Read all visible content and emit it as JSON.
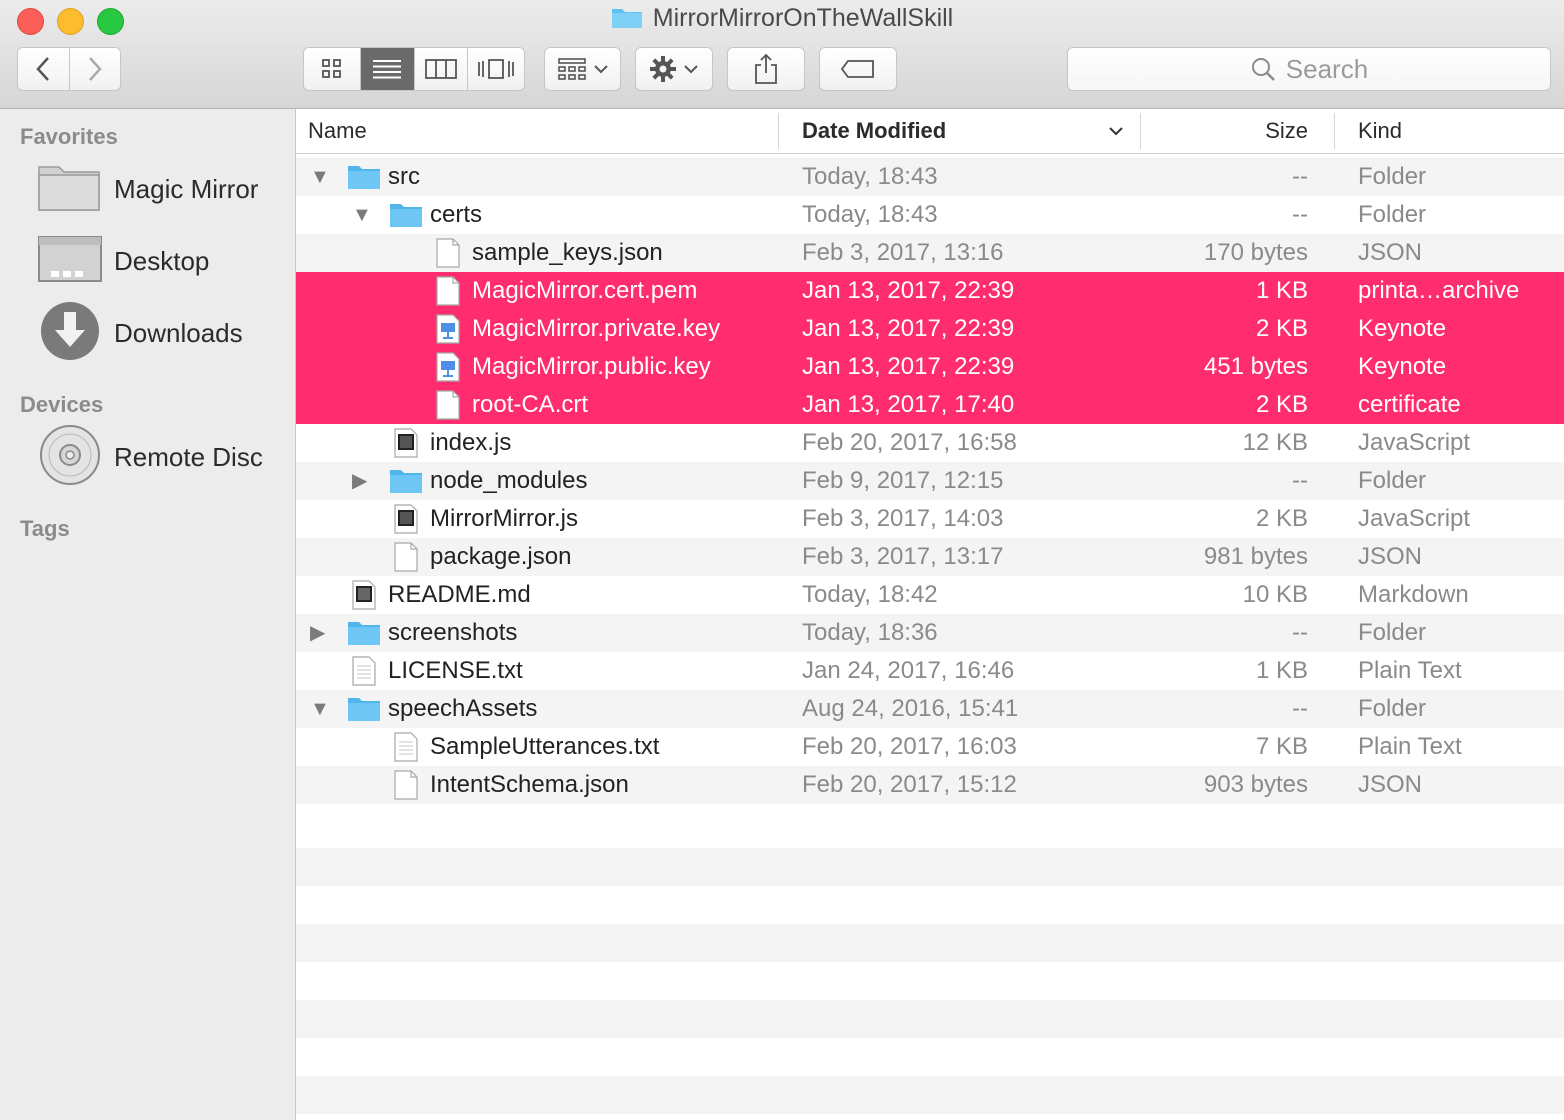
{
  "window": {
    "title": "MirrorMirrorOnTheWallSkill"
  },
  "toolbar": {
    "search_placeholder": "Search",
    "view_modes": [
      "icon-view",
      "list-view",
      "column-view",
      "cover-flow-view"
    ],
    "active_view": "list-view"
  },
  "sidebar": {
    "favorites_header": "Favorites",
    "favorites": [
      {
        "label": "Magic Mirror",
        "icon": "folder-icon"
      },
      {
        "label": "Desktop",
        "icon": "desktop-icon"
      },
      {
        "label": "Downloads",
        "icon": "downloads-icon"
      }
    ],
    "devices_header": "Devices",
    "devices": [
      {
        "label": "Remote Disc",
        "icon": "disc-icon"
      }
    ],
    "tags_header": "Tags"
  },
  "columns": {
    "name": "Name",
    "date": "Date Modified",
    "size": "Size",
    "kind": "Kind"
  },
  "rows": [
    {
      "name": "src",
      "date": "Today, 18:43",
      "size": "--",
      "kind": "Folder",
      "level": 0,
      "type": "folder",
      "expanded": true,
      "selected": false
    },
    {
      "name": "certs",
      "date": "Today, 18:43",
      "size": "--",
      "kind": "Folder",
      "level": 1,
      "type": "folder",
      "expanded": true,
      "selected": false
    },
    {
      "name": "sample_keys.json",
      "date": "Feb 3, 2017, 13:16",
      "size": "170 bytes",
      "kind": "JSON",
      "level": 2,
      "type": "file",
      "selected": false
    },
    {
      "name": "MagicMirror.cert.pem",
      "date": "Jan 13, 2017, 22:39",
      "size": "1 KB",
      "kind": "printa…archive",
      "level": 2,
      "type": "file",
      "selected": true
    },
    {
      "name": "MagicMirror.private.key",
      "date": "Jan 13, 2017, 22:39",
      "size": "2 KB",
      "kind": "Keynote",
      "level": 2,
      "type": "keynote",
      "selected": true
    },
    {
      "name": "MagicMirror.public.key",
      "date": "Jan 13, 2017, 22:39",
      "size": "451 bytes",
      "kind": "Keynote",
      "level": 2,
      "type": "keynote",
      "selected": true
    },
    {
      "name": "root-CA.crt",
      "date": "Jan 13, 2017, 17:40",
      "size": "2 KB",
      "kind": "certificate",
      "level": 2,
      "type": "file",
      "selected": true
    },
    {
      "name": "index.js",
      "date": "Feb 20, 2017, 16:58",
      "size": "12 KB",
      "kind": "JavaScript",
      "level": 1,
      "type": "js",
      "selected": false
    },
    {
      "name": "node_modules",
      "date": "Feb 9, 2017, 12:15",
      "size": "--",
      "kind": "Folder",
      "level": 1,
      "type": "folder",
      "expanded": false,
      "selected": false
    },
    {
      "name": "MirrorMirror.js",
      "date": "Feb 3, 2017, 14:03",
      "size": "2 KB",
      "kind": "JavaScript",
      "level": 1,
      "type": "js",
      "selected": false
    },
    {
      "name": "package.json",
      "date": "Feb 3, 2017, 13:17",
      "size": "981 bytes",
      "kind": "JSON",
      "level": 1,
      "type": "file",
      "selected": false
    },
    {
      "name": "README.md",
      "date": "Today, 18:42",
      "size": "10 KB",
      "kind": "Markdown",
      "level": 0,
      "type": "md",
      "selected": false
    },
    {
      "name": "screenshots",
      "date": "Today, 18:36",
      "size": "--",
      "kind": "Folder",
      "level": 0,
      "type": "folder",
      "expanded": false,
      "selected": false
    },
    {
      "name": "LICENSE.txt",
      "date": "Jan 24, 2017, 16:46",
      "size": "1 KB",
      "kind": "Plain Text",
      "level": 0,
      "type": "txt",
      "selected": false
    },
    {
      "name": "speechAssets",
      "date": "Aug 24, 2016, 15:41",
      "size": "--",
      "kind": "Folder",
      "level": 0,
      "type": "folder",
      "expanded": true,
      "selected": false
    },
    {
      "name": "SampleUtterances.txt",
      "date": "Feb 20, 2017, 16:03",
      "size": "7 KB",
      "kind": "Plain Text",
      "level": 1,
      "type": "txt",
      "selected": false
    },
    {
      "name": "IntentSchema.json",
      "date": "Feb 20, 2017, 15:12",
      "size": "903 bytes",
      "kind": "JSON",
      "level": 1,
      "type": "file",
      "selected": false
    }
  ],
  "colors": {
    "selection": "#ff2d6f",
    "folder": "#5ec2f2",
    "stripe": "#f4f4f4"
  }
}
